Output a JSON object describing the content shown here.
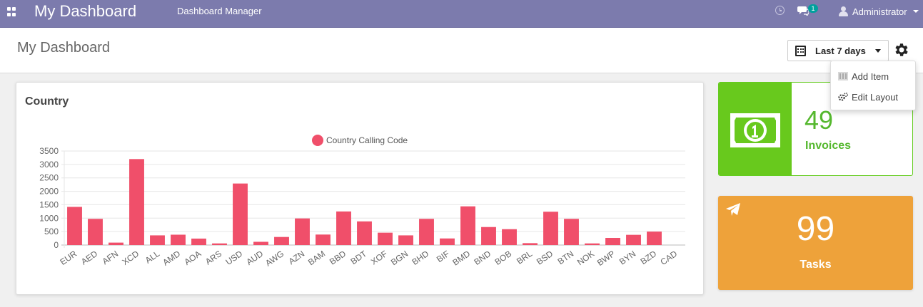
{
  "navbar": {
    "brand": "My Dashboard",
    "menu_item": "Dashboard Manager",
    "chat_badge": "1",
    "user_name": "Administrator"
  },
  "control_panel": {
    "title": "My Dashboard",
    "date_filter": "Last 7 days"
  },
  "settings_menu": {
    "items": [
      {
        "label": "Add Item",
        "icon": "add-item-icon"
      },
      {
        "label": "Edit Layout",
        "icon": "gears-icon"
      }
    ]
  },
  "chart_card": {
    "title": "Country"
  },
  "chart_data": {
    "type": "bar",
    "title": "Country",
    "categories": [
      "EUR",
      "AED",
      "AFN",
      "XCD",
      "ALL",
      "AMD",
      "AOA",
      "ARS",
      "USD",
      "AUD",
      "AWG",
      "AZN",
      "BAM",
      "BBD",
      "BDT",
      "XOF",
      "BGN",
      "BHD",
      "BIF",
      "BMD",
      "BND",
      "BOB",
      "BRL",
      "BSD",
      "BTN",
      "NOK",
      "BWP",
      "BYN",
      "BZD",
      "CAD"
    ],
    "series": [
      {
        "name": "Country Calling Code",
        "values": [
          1420,
          975,
          90,
          3200,
          360,
          385,
          240,
          60,
          2290,
          120,
          300,
          990,
          390,
          1250,
          880,
          460,
          360,
          975,
          245,
          1440,
          670,
          590,
          70,
          1240,
          975,
          60,
          265,
          380,
          500,
          0
        ]
      }
    ],
    "y_ticks": [
      0,
      500,
      1000,
      1500,
      2000,
      2500,
      3000,
      3500
    ],
    "ylim": [
      0,
      3500
    ],
    "legend_position": "top-center",
    "grid": true,
    "colors": {
      "bar": "#f04f6a"
    }
  },
  "kpis": {
    "invoices": {
      "value": "49",
      "label": "Invoices",
      "color": "#68c91d"
    },
    "tasks": {
      "value": "99",
      "label": "Tasks",
      "color": "#eea23a"
    }
  }
}
